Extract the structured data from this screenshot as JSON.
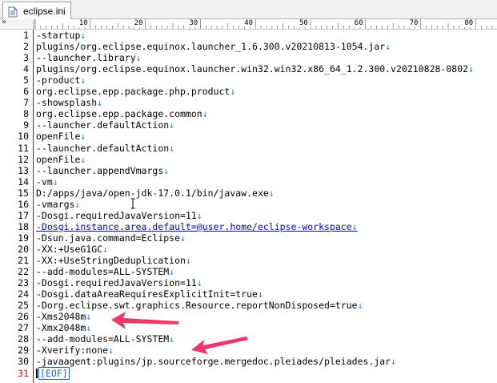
{
  "tab": {
    "label": "eclipse.ini",
    "icon": "document-icon"
  },
  "ruler": {
    "marker": "»",
    "labels": [
      "10",
      "20",
      "30",
      "40",
      "50",
      "60",
      "70",
      "80"
    ]
  },
  "editor": {
    "eol_glyph": "↓",
    "eof_label": "[EOF]",
    "lines": [
      {
        "n": "1",
        "text": "-startup"
      },
      {
        "n": "2",
        "text": "plugins/org.eclipse.equinox.launcher_1.6.300.v20210813-1054.jar"
      },
      {
        "n": "3",
        "text": "--launcher.library"
      },
      {
        "n": "4",
        "text": "plugins/org.eclipse.equinox.launcher.win32.win32.x86_64_1.2.300.v20210828-0802"
      },
      {
        "n": "5",
        "text": "-product"
      },
      {
        "n": "6",
        "text": "org.eclipse.epp.package.php.product"
      },
      {
        "n": "7",
        "text": "-showsplash"
      },
      {
        "n": "8",
        "text": "org.eclipse.epp.package.common"
      },
      {
        "n": "9",
        "text": "--launcher.defaultAction"
      },
      {
        "n": "10",
        "text": "openFile"
      },
      {
        "n": "11",
        "text": "--launcher.defaultAction"
      },
      {
        "n": "12",
        "text": "openFile"
      },
      {
        "n": "13",
        "text": "--launcher.appendVmargs"
      },
      {
        "n": "14",
        "text": "-vm"
      },
      {
        "n": "15",
        "text": "D:/apps/java/open-jdk-17.0.1/bin/javaw.exe"
      },
      {
        "n": "16",
        "text": "-vmargs"
      },
      {
        "n": "17",
        "text": "-Dosgi.requiredJavaVersion=11"
      },
      {
        "n": "18",
        "text": "-Dosgi.instance.area.default=@user.home/eclipse-workspace"
      },
      {
        "n": "19",
        "text": "-Dsun.java.command=Eclipse"
      },
      {
        "n": "20",
        "text": "-XX:+UseG1GC"
      },
      {
        "n": "21",
        "text": "-XX:+UseStringDeduplication"
      },
      {
        "n": "22",
        "text": "--add-modules=ALL-SYSTEM"
      },
      {
        "n": "23",
        "text": "-Dosgi.requiredJavaVersion=11"
      },
      {
        "n": "24",
        "text": "-Dosgi.dataAreaRequiresExplicitInit=true"
      },
      {
        "n": "25",
        "text": "-Dorg.eclipse.swt.graphics.Resource.reportNonDisposed=true"
      },
      {
        "n": "26",
        "text": "-Xms2048m"
      },
      {
        "n": "27",
        "text": "-Xmx2048m"
      },
      {
        "n": "28",
        "text": "--add-modules=ALL-SYSTEM"
      },
      {
        "n": "29",
        "text": "-Xverify:none"
      },
      {
        "n": "30",
        "text": "-javaagent:plugins/jp.sourceforge.mergedoc.pleiades/pleiades.jar"
      },
      {
        "n": "31",
        "text": ""
      }
    ]
  },
  "colors": {
    "eol": "#2f7bd8",
    "link": "#0000c8",
    "current_line_number": "#d00000",
    "annotation_arrow": "#f0356a"
  }
}
